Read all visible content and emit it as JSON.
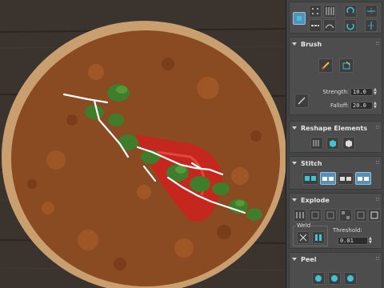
{
  "panel": {
    "brush": {
      "title": "Brush",
      "strength_label": "Strength:",
      "strength_value": "10.0",
      "falloff_label": "Falloff:",
      "falloff_value": "20.0"
    },
    "reshape": {
      "title": "Reshape Elements"
    },
    "stitch": {
      "title": "Stitch"
    },
    "explode": {
      "title": "Explode",
      "weld_label": "Weld",
      "threshold_label": "Threshold:",
      "threshold_value": "0.01"
    },
    "peel": {
      "title": "Peel"
    }
  },
  "colors": {
    "panel_bg": "#444444",
    "accent_blue": "#5a8fb5",
    "icon_cyan": "#3fc3d6",
    "seam_white": "#ffffff",
    "tomato_red": "#c5271e",
    "parsley_green": "#3f7d2c"
  }
}
